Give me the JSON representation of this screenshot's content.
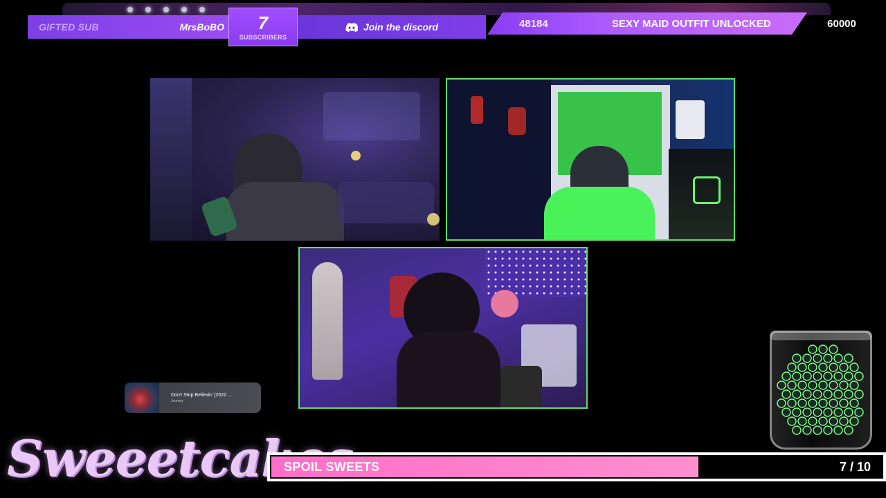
{
  "alerts": {
    "gifted_label": "GIFTED SUB",
    "gifted_user": "MrsBoBO",
    "subscriber_count": "7",
    "subscriber_caption": "SUBSCRIBERS",
    "discord_text": "Join the discord",
    "goal_current": "48184",
    "goal_text": "SEXY MAID OUTFIT UNLOCKED",
    "goal_target": "60000"
  },
  "music": {
    "song": "Don't Stop Believin' (2022 ...",
    "artist": "Journey"
  },
  "branding": {
    "name": "Sweeetcakes"
  },
  "progress": {
    "label": "SPOIL SWEETS",
    "count": "7 / 10",
    "current": 7,
    "goal": 10
  },
  "colors": {
    "accent_purple": "#9a4cf0",
    "cam_border_green": "#5fdc6b",
    "progress_pink": "#ff6ec7"
  },
  "icons": {
    "discord": "discord-icon",
    "jar": "candy-jar-icon",
    "album_art": "album-art-icon"
  }
}
